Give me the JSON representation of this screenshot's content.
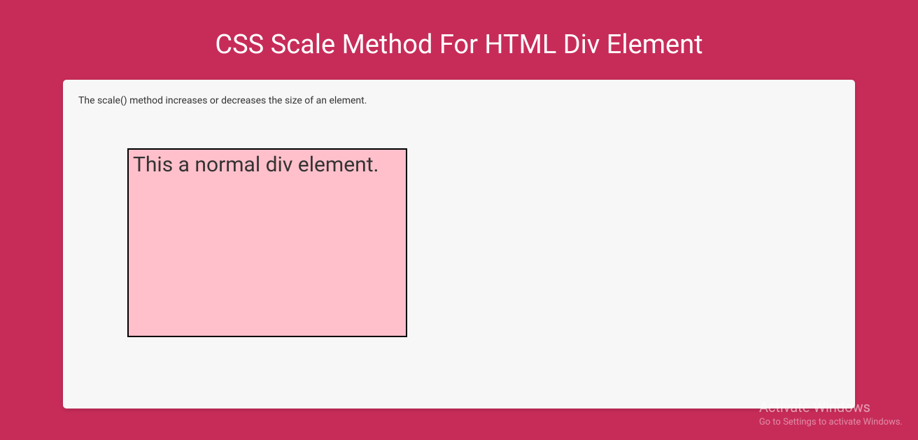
{
  "header": {
    "title": "CSS Scale Method For HTML Div Element"
  },
  "card": {
    "description": "The scale() method increases or decreases the size of an element.",
    "demo_text": "This a normal div element."
  },
  "watermark": {
    "title": "Activate Windows",
    "subtitle": "Go to Settings to activate Windows."
  }
}
